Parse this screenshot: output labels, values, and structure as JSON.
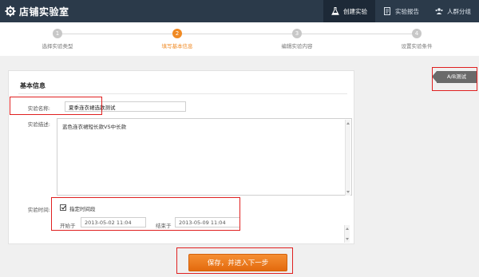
{
  "app": {
    "title": "店铺实验室",
    "logo_icon": "gear-logo-icon"
  },
  "nav": [
    {
      "label": "创建实验",
      "icon": "flask-icon",
      "active": true
    },
    {
      "label": "实验报告",
      "icon": "report-icon",
      "active": false
    },
    {
      "label": "人群分组",
      "icon": "people-icon",
      "active": false
    }
  ],
  "steps": [
    {
      "num": "1",
      "label": "选择实验类型",
      "active": false
    },
    {
      "num": "2",
      "label": "填写基本信息",
      "active": true
    },
    {
      "num": "3",
      "label": "编辑实验内容",
      "active": false
    },
    {
      "num": "4",
      "label": "设置实验条件",
      "active": false
    }
  ],
  "section": {
    "title": "基本信息"
  },
  "form": {
    "name_label": "实验名称:",
    "name_value": "夏季连衣裙选款测试",
    "desc_label": "实验描述:",
    "desc_value": "蓝色连衣裙短长款VS中长款",
    "time_label": "实验时间:",
    "fixed_time_label": "指定时间段",
    "fixed_time_checked": true,
    "start_label": "开始于",
    "start_value": "2013-05-02 11:04",
    "end_label": "结束于",
    "end_value": "2013-05-09 11:04"
  },
  "ab_tag": "A/B测试",
  "save_button": "保存，并进入下一步",
  "colors": {
    "topbar": "#2b3a4a",
    "accent": "#f08a24",
    "highlight": "#e02020"
  }
}
